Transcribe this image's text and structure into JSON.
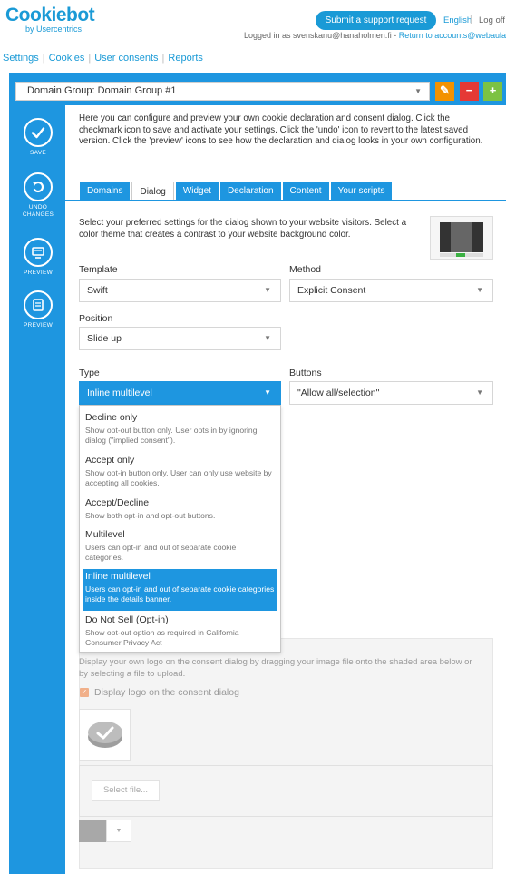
{
  "brand": {
    "name": "Cookiebot",
    "sub": "by Usercentrics"
  },
  "header": {
    "support_button": "Submit a support request",
    "language": "English",
    "logoff": "Log off",
    "logged_in_prefix": "Logged in as svenskanu@hanaholmen.fi - ",
    "return_link": "Return to accounts@webaula.fi"
  },
  "topnav": {
    "items": [
      "Settings",
      "Cookies",
      "User consents",
      "Reports"
    ]
  },
  "domain_group": {
    "value": "Domain Group: Domain Group #1"
  },
  "sidebar": {
    "save": "SAVE",
    "undo_1": "UNDO",
    "undo_2": "CHANGES",
    "preview1": "PREVIEW",
    "preview2": "PREVIEW"
  },
  "intro": "Here you can configure and preview your own cookie declaration and consent dialog. Click the checkmark icon to save and activate your settings. Click the 'undo' icon to revert to the latest saved version. Click the 'preview' icons to see how the declaration and dialog looks in your own configuration.",
  "tabs": [
    "Domains",
    "Dialog",
    "Widget",
    "Declaration",
    "Content",
    "Your scripts"
  ],
  "dialog_intro": "Select your preferred settings for the dialog shown to your website visitors. Select a color theme that creates a contrast to your website background color.",
  "fields": {
    "template": {
      "label": "Template",
      "value": "Swift"
    },
    "method": {
      "label": "Method",
      "value": "Explicit Consent"
    },
    "position": {
      "label": "Position",
      "value": "Slide up"
    },
    "type": {
      "label": "Type",
      "value": "Inline multilevel"
    },
    "buttons": {
      "label": "Buttons",
      "value": "\"Allow all/selection\""
    }
  },
  "type_options": [
    {
      "title": "Decline only",
      "desc": "Show opt-out button only. User opts in by ignoring dialog (\"implied consent\")."
    },
    {
      "title": "Accept only",
      "desc": "Show opt-in button only. User can only use website by accepting all cookies."
    },
    {
      "title": "Accept/Decline",
      "desc": "Show both opt-in and opt-out buttons."
    },
    {
      "title": "Multilevel",
      "desc": "Users can opt-in and out of separate cookie categories."
    },
    {
      "title": "Inline multilevel",
      "desc": "Users can opt-in and out of separate cookie categories inside the details banner."
    },
    {
      "title": "Do Not Sell (Opt-in)",
      "desc": "Show opt-out option as required in California Consumer Privacy Act"
    }
  ],
  "logo_section": {
    "text": "Display your own logo on the consent dialog by dragging your image file onto the shaded area below or by selecting a file to upload.",
    "checkbox_label": "Display logo on the consent dialog",
    "select_file": "Select file..."
  },
  "colors": {
    "accent": "#1e96e0",
    "orange": "#f39200",
    "red": "#e53935",
    "green": "#7cc242",
    "swatch": "#a8a8a8"
  }
}
